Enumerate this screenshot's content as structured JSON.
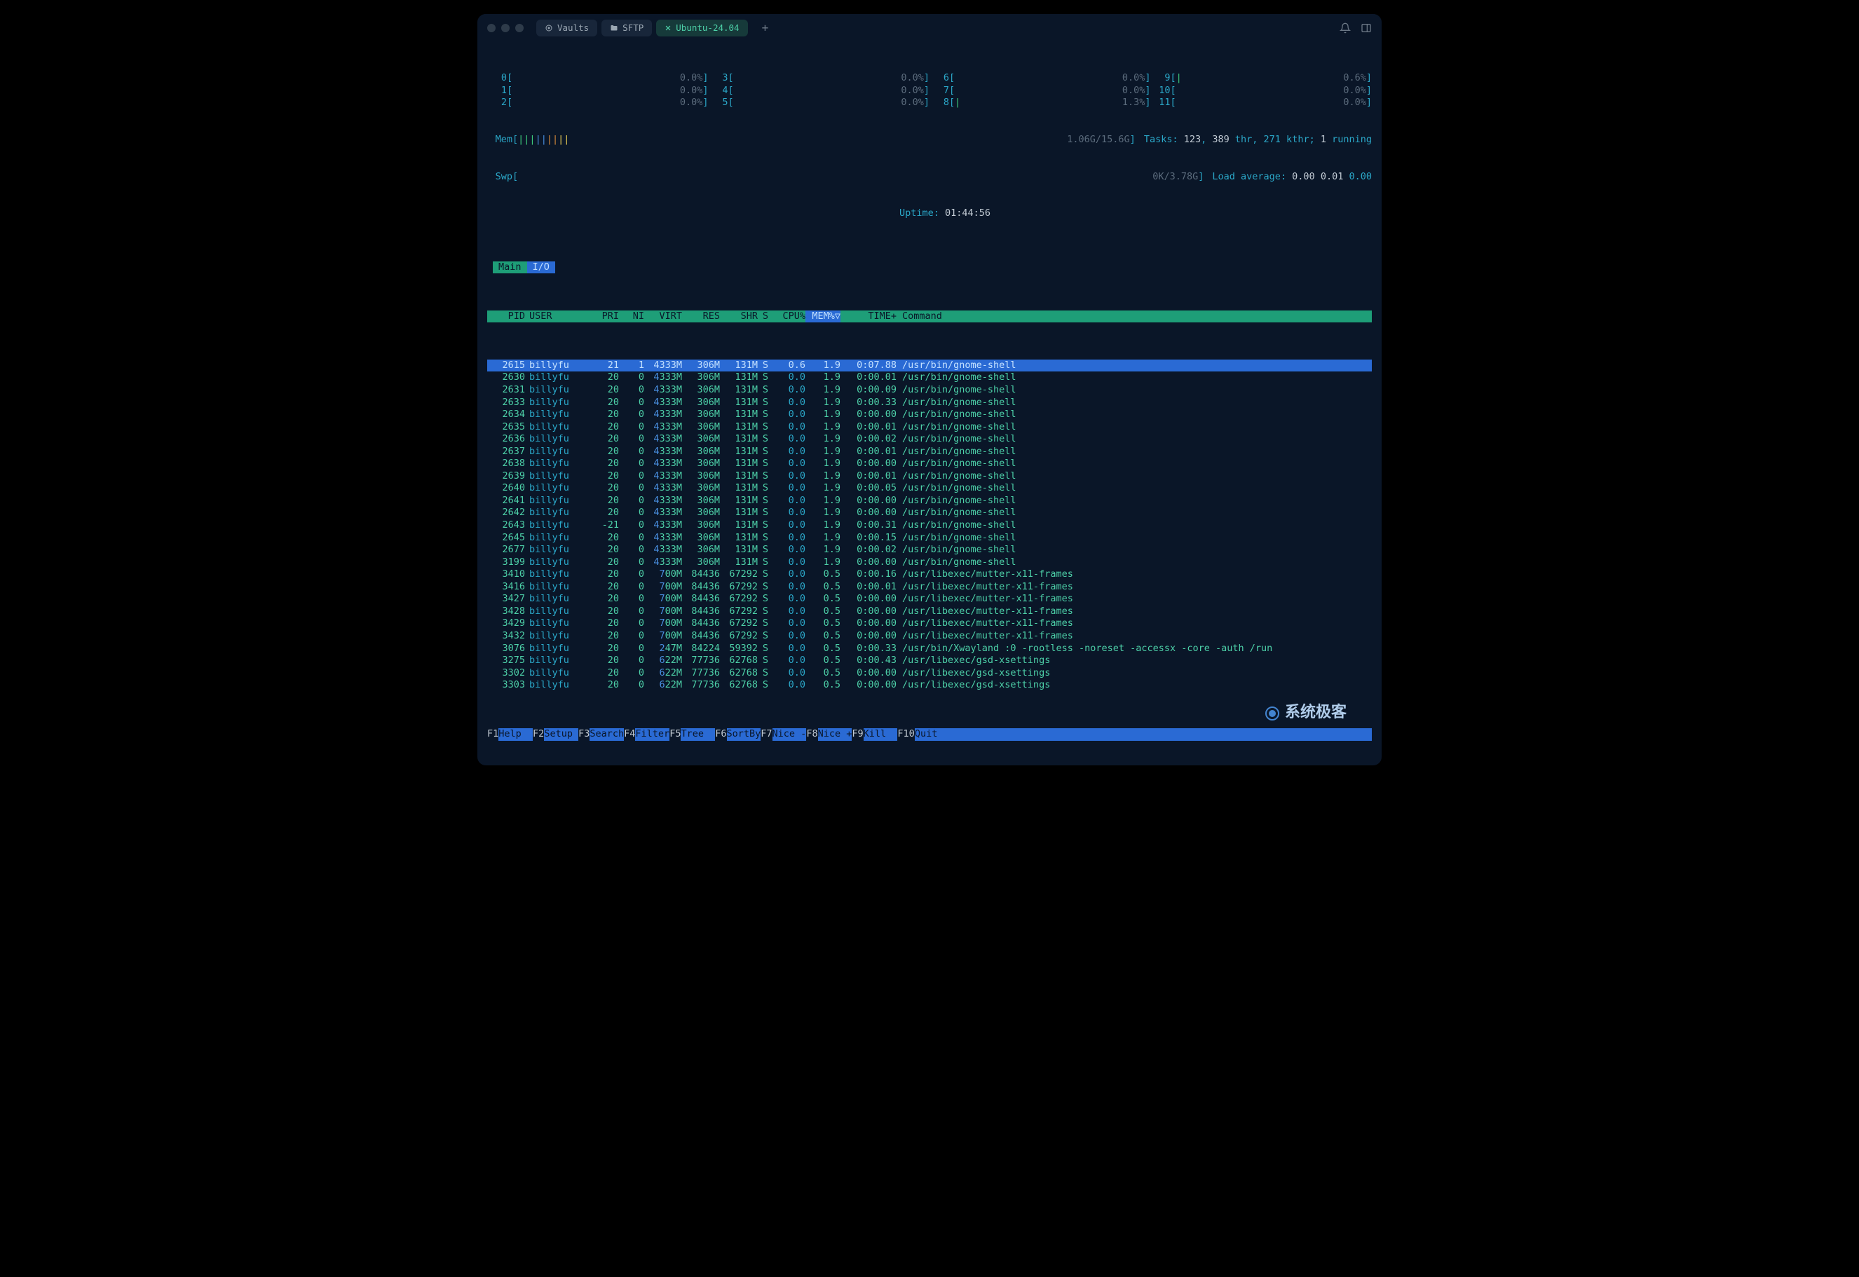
{
  "titlebar": {
    "tabs": [
      {
        "icon": "vault-icon",
        "label": "Vaults"
      },
      {
        "icon": "folder-icon",
        "label": "SFTP"
      },
      {
        "icon": "close-icon",
        "label": "Ubuntu-24.04",
        "active": true
      }
    ]
  },
  "cpu_meters": [
    {
      "id": "0",
      "bar": "",
      "pct": "0.0%"
    },
    {
      "id": "1",
      "bar": "",
      "pct": "0.0%"
    },
    {
      "id": "2",
      "bar": "",
      "pct": "0.0%"
    },
    {
      "id": "3",
      "bar": "",
      "pct": "0.0%"
    },
    {
      "id": "4",
      "bar": "",
      "pct": "0.0%"
    },
    {
      "id": "5",
      "bar": "",
      "pct": "0.0%"
    },
    {
      "id": "6",
      "bar": "",
      "pct": "0.0%"
    },
    {
      "id": "7",
      "bar": "",
      "pct": "0.0%"
    },
    {
      "id": "8",
      "bar": "|",
      "pct": "1.3%"
    },
    {
      "id": "9",
      "bar": "|",
      "pct": "0.6%"
    },
    {
      "id": "10",
      "bar": "",
      "pct": "0.0%"
    },
    {
      "id": "11",
      "bar": "",
      "pct": "0.0%"
    }
  ],
  "mem": {
    "label": "Mem",
    "bars": "|||||||||",
    "value": "1.06G/15.6G"
  },
  "swp": {
    "label": "Swp",
    "bars": "",
    "value": "0K/3.78G"
  },
  "tasks_line": {
    "label": "Tasks: ",
    "tasks": "123",
    "sep1": ", ",
    "threads": "389",
    "thr": " thr, ",
    "kthr": "271 kthr; ",
    "running": "1",
    "running_lbl": " running"
  },
  "loadavg": {
    "label": "Load average: ",
    "v1": "0.00",
    "v2": "0.01",
    "v3": "0.00"
  },
  "uptime": {
    "label": "Uptime: ",
    "value": "01:44:56"
  },
  "tabs": {
    "main": "Main",
    "io": "I/O"
  },
  "columns": {
    "pid": "PID",
    "user": "USER",
    "pri": "PRI",
    "ni": "NI",
    "virt": "VIRT",
    "res": "RES",
    "shr": "SHR",
    "s": "S",
    "cpu": "CPU%",
    "mem": "MEM%▽",
    "time": "TIME+",
    "cmd": "Command"
  },
  "processes": [
    {
      "pid": "2615",
      "user": "billyfu",
      "pri": "21",
      "ni": "1",
      "virt": "4333M",
      "res": "306M",
      "shr": "131M",
      "s": "S",
      "cpu": "0.6",
      "mem": "1.9",
      "time": "0:07.88",
      "cmd": "/usr/bin/gnome-shell",
      "selected": true
    },
    {
      "pid": "2630",
      "user": "billyfu",
      "pri": "20",
      "ni": "0",
      "virt": "4333M",
      "res": "306M",
      "shr": "131M",
      "s": "S",
      "cpu": "0.0",
      "mem": "1.9",
      "time": "0:00.01",
      "cmd": "/usr/bin/gnome-shell"
    },
    {
      "pid": "2631",
      "user": "billyfu",
      "pri": "20",
      "ni": "0",
      "virt": "4333M",
      "res": "306M",
      "shr": "131M",
      "s": "S",
      "cpu": "0.0",
      "mem": "1.9",
      "time": "0:00.09",
      "cmd": "/usr/bin/gnome-shell"
    },
    {
      "pid": "2633",
      "user": "billyfu",
      "pri": "20",
      "ni": "0",
      "virt": "4333M",
      "res": "306M",
      "shr": "131M",
      "s": "S",
      "cpu": "0.0",
      "mem": "1.9",
      "time": "0:00.33",
      "cmd": "/usr/bin/gnome-shell"
    },
    {
      "pid": "2634",
      "user": "billyfu",
      "pri": "20",
      "ni": "0",
      "virt": "4333M",
      "res": "306M",
      "shr": "131M",
      "s": "S",
      "cpu": "0.0",
      "mem": "1.9",
      "time": "0:00.00",
      "cmd": "/usr/bin/gnome-shell"
    },
    {
      "pid": "2635",
      "user": "billyfu",
      "pri": "20",
      "ni": "0",
      "virt": "4333M",
      "res": "306M",
      "shr": "131M",
      "s": "S",
      "cpu": "0.0",
      "mem": "1.9",
      "time": "0:00.01",
      "cmd": "/usr/bin/gnome-shell"
    },
    {
      "pid": "2636",
      "user": "billyfu",
      "pri": "20",
      "ni": "0",
      "virt": "4333M",
      "res": "306M",
      "shr": "131M",
      "s": "S",
      "cpu": "0.0",
      "mem": "1.9",
      "time": "0:00.02",
      "cmd": "/usr/bin/gnome-shell"
    },
    {
      "pid": "2637",
      "user": "billyfu",
      "pri": "20",
      "ni": "0",
      "virt": "4333M",
      "res": "306M",
      "shr": "131M",
      "s": "S",
      "cpu": "0.0",
      "mem": "1.9",
      "time": "0:00.01",
      "cmd": "/usr/bin/gnome-shell"
    },
    {
      "pid": "2638",
      "user": "billyfu",
      "pri": "20",
      "ni": "0",
      "virt": "4333M",
      "res": "306M",
      "shr": "131M",
      "s": "S",
      "cpu": "0.0",
      "mem": "1.9",
      "time": "0:00.00",
      "cmd": "/usr/bin/gnome-shell"
    },
    {
      "pid": "2639",
      "user": "billyfu",
      "pri": "20",
      "ni": "0",
      "virt": "4333M",
      "res": "306M",
      "shr": "131M",
      "s": "S",
      "cpu": "0.0",
      "mem": "1.9",
      "time": "0:00.01",
      "cmd": "/usr/bin/gnome-shell"
    },
    {
      "pid": "2640",
      "user": "billyfu",
      "pri": "20",
      "ni": "0",
      "virt": "4333M",
      "res": "306M",
      "shr": "131M",
      "s": "S",
      "cpu": "0.0",
      "mem": "1.9",
      "time": "0:00.05",
      "cmd": "/usr/bin/gnome-shell"
    },
    {
      "pid": "2641",
      "user": "billyfu",
      "pri": "20",
      "ni": "0",
      "virt": "4333M",
      "res": "306M",
      "shr": "131M",
      "s": "S",
      "cpu": "0.0",
      "mem": "1.9",
      "time": "0:00.00",
      "cmd": "/usr/bin/gnome-shell"
    },
    {
      "pid": "2642",
      "user": "billyfu",
      "pri": "20",
      "ni": "0",
      "virt": "4333M",
      "res": "306M",
      "shr": "131M",
      "s": "S",
      "cpu": "0.0",
      "mem": "1.9",
      "time": "0:00.00",
      "cmd": "/usr/bin/gnome-shell"
    },
    {
      "pid": "2643",
      "user": "billyfu",
      "pri": "-21",
      "ni": "0",
      "virt": "4333M",
      "res": "306M",
      "shr": "131M",
      "s": "S",
      "cpu": "0.0",
      "mem": "1.9",
      "time": "0:00.31",
      "cmd": "/usr/bin/gnome-shell"
    },
    {
      "pid": "2645",
      "user": "billyfu",
      "pri": "20",
      "ni": "0",
      "virt": "4333M",
      "res": "306M",
      "shr": "131M",
      "s": "S",
      "cpu": "0.0",
      "mem": "1.9",
      "time": "0:00.15",
      "cmd": "/usr/bin/gnome-shell"
    },
    {
      "pid": "2677",
      "user": "billyfu",
      "pri": "20",
      "ni": "0",
      "virt": "4333M",
      "res": "306M",
      "shr": "131M",
      "s": "S",
      "cpu": "0.0",
      "mem": "1.9",
      "time": "0:00.02",
      "cmd": "/usr/bin/gnome-shell"
    },
    {
      "pid": "3199",
      "user": "billyfu",
      "pri": "20",
      "ni": "0",
      "virt": "4333M",
      "res": "306M",
      "shr": "131M",
      "s": "S",
      "cpu": "0.0",
      "mem": "1.9",
      "time": "0:00.00",
      "cmd": "/usr/bin/gnome-shell"
    },
    {
      "pid": "3410",
      "user": "billyfu",
      "pri": "20",
      "ni": "0",
      "virt": "700M",
      "res": "84436",
      "shr": "67292",
      "s": "S",
      "cpu": "0.0",
      "mem": "0.5",
      "time": "0:00.16",
      "cmd": "/usr/libexec/mutter-x11-frames"
    },
    {
      "pid": "3416",
      "user": "billyfu",
      "pri": "20",
      "ni": "0",
      "virt": "700M",
      "res": "84436",
      "shr": "67292",
      "s": "S",
      "cpu": "0.0",
      "mem": "0.5",
      "time": "0:00.01",
      "cmd": "/usr/libexec/mutter-x11-frames"
    },
    {
      "pid": "3427",
      "user": "billyfu",
      "pri": "20",
      "ni": "0",
      "virt": "700M",
      "res": "84436",
      "shr": "67292",
      "s": "S",
      "cpu": "0.0",
      "mem": "0.5",
      "time": "0:00.00",
      "cmd": "/usr/libexec/mutter-x11-frames"
    },
    {
      "pid": "3428",
      "user": "billyfu",
      "pri": "20",
      "ni": "0",
      "virt": "700M",
      "res": "84436",
      "shr": "67292",
      "s": "S",
      "cpu": "0.0",
      "mem": "0.5",
      "time": "0:00.00",
      "cmd": "/usr/libexec/mutter-x11-frames"
    },
    {
      "pid": "3429",
      "user": "billyfu",
      "pri": "20",
      "ni": "0",
      "virt": "700M",
      "res": "84436",
      "shr": "67292",
      "s": "S",
      "cpu": "0.0",
      "mem": "0.5",
      "time": "0:00.00",
      "cmd": "/usr/libexec/mutter-x11-frames"
    },
    {
      "pid": "3432",
      "user": "billyfu",
      "pri": "20",
      "ni": "0",
      "virt": "700M",
      "res": "84436",
      "shr": "67292",
      "s": "S",
      "cpu": "0.0",
      "mem": "0.5",
      "time": "0:00.00",
      "cmd": "/usr/libexec/mutter-x11-frames"
    },
    {
      "pid": "3076",
      "user": "billyfu",
      "pri": "20",
      "ni": "0",
      "virt": "247M",
      "res": "84224",
      "shr": "59392",
      "s": "S",
      "cpu": "0.0",
      "mem": "0.5",
      "time": "0:00.33",
      "cmd": "/usr/bin/Xwayland :0 -rootless -noreset -accessx -core -auth /run"
    },
    {
      "pid": "3275",
      "user": "billyfu",
      "pri": "20",
      "ni": "0",
      "virt": "622M",
      "res": "77736",
      "shr": "62768",
      "s": "S",
      "cpu": "0.0",
      "mem": "0.5",
      "time": "0:00.43",
      "cmd": "/usr/libexec/gsd-xsettings"
    },
    {
      "pid": "3302",
      "user": "billyfu",
      "pri": "20",
      "ni": "0",
      "virt": "622M",
      "res": "77736",
      "shr": "62768",
      "s": "S",
      "cpu": "0.0",
      "mem": "0.5",
      "time": "0:00.00",
      "cmd": "/usr/libexec/gsd-xsettings"
    },
    {
      "pid": "3303",
      "user": "billyfu",
      "pri": "20",
      "ni": "0",
      "virt": "622M",
      "res": "77736",
      "shr": "62768",
      "s": "S",
      "cpu": "0.0",
      "mem": "0.5",
      "time": "0:00.00",
      "cmd": "/usr/libexec/gsd-xsettings"
    }
  ],
  "fn_keys": [
    {
      "key": "F1",
      "label": "Help  "
    },
    {
      "key": "F2",
      "label": "Setup "
    },
    {
      "key": "F3",
      "label": "Search"
    },
    {
      "key": "F4",
      "label": "Filter"
    },
    {
      "key": "F5",
      "label": "Tree  "
    },
    {
      "key": "F6",
      "label": "SortBy"
    },
    {
      "key": "F7",
      "label": "Nice -"
    },
    {
      "key": "F8",
      "label": "Nice +"
    },
    {
      "key": "F9",
      "label": "Kill  "
    },
    {
      "key": "F10",
      "label": "Quit  "
    }
  ],
  "watermark": "系统极客"
}
